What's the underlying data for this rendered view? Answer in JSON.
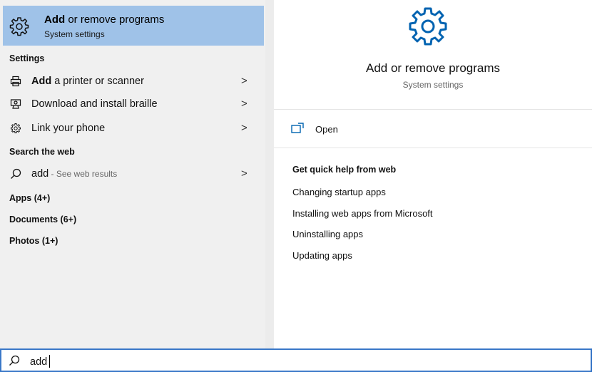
{
  "top_result": {
    "title_bold": "Add",
    "title_rest": " or remove programs",
    "subtitle": "System settings",
    "icon": "gear-icon"
  },
  "sections": {
    "settings": "Settings",
    "search_web": "Search the web",
    "apps": "Apps (4+)",
    "documents": "Documents (6+)",
    "photos": "Photos (1+)"
  },
  "settings_items": [
    {
      "bold": "Add",
      "rest": " a printer or scanner",
      "icon": "printer-icon"
    },
    {
      "bold": "",
      "rest": "Download and install braille",
      "icon": "braille-display-icon"
    },
    {
      "bold": "",
      "rest": "Link your phone",
      "icon": "gear-icon"
    }
  ],
  "web_item": {
    "query": "add",
    "suffix": " - See web results",
    "icon": "search-icon"
  },
  "chevron": ">",
  "detail": {
    "title": "Add or remove programs",
    "subtitle": "System settings",
    "open_label": "Open",
    "help_heading": "Get quick help from web",
    "help_links": [
      "Changing startup apps",
      "Installing web apps from Microsoft",
      "Uninstalling apps",
      "Updating apps"
    ]
  },
  "search": {
    "value": "add"
  },
  "colors": {
    "selected_bg": "#9fc2e8",
    "accent": "#0063b1",
    "left_bg": "#f0f0f0",
    "search_border": "#3a78c8"
  }
}
